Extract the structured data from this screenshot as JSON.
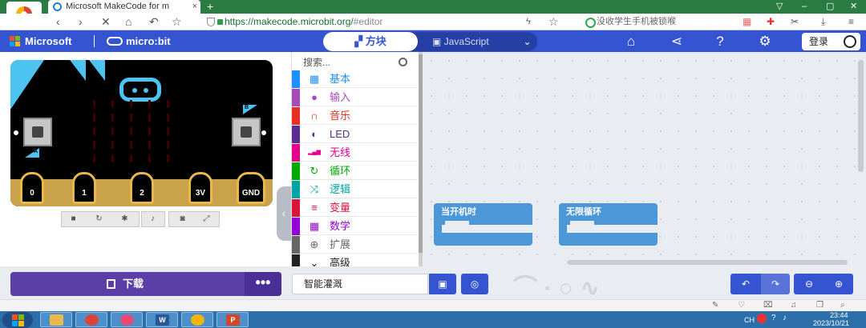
{
  "browser": {
    "tab_title": "Microsoft MakeCode for m",
    "tab_close": "×",
    "new_tab": "+",
    "url_main": "https://makecode.microbit.org/",
    "url_hash": "#editor",
    "search_text": "没收学生手机被锁喉",
    "window_controls": [
      "▽",
      "–",
      "▢",
      "✕"
    ],
    "nav_icons": [
      "back-icon",
      "forward-icon",
      "close-icon",
      "home-icon",
      "undo-icon",
      "star-icon"
    ]
  },
  "header": {
    "brand": "Microsoft",
    "product": "micro:bit",
    "mode_blocks": "方块",
    "mode_js": "JavaScript",
    "login": "登录",
    "colors": {
      "bar": "#3454d1",
      "accent": "#263fa5"
    }
  },
  "simulator": {
    "button_a": "A",
    "button_b": "B",
    "pins": [
      "0",
      "1",
      "2",
      "3V",
      "GND"
    ],
    "controls": [
      "stop-icon",
      "restart-icon",
      "debug-icon",
      "sound-icon",
      "screenshot-icon",
      "fullscreen-icon"
    ]
  },
  "toolbox": {
    "search_placeholder": "搜索...",
    "categories": [
      {
        "label": "基本",
        "color": "#1e90ff",
        "icon": "grid-icon"
      },
      {
        "label": "输入",
        "color": "#a54cb8",
        "icon": "circle-icon"
      },
      {
        "label": "音乐",
        "color": "#e63022",
        "icon": "headphones-icon"
      },
      {
        "label": "LED",
        "color": "#5c2d91",
        "icon": "toggle-icon"
      },
      {
        "label": "无线",
        "color": "#e3008c",
        "icon": "signal-icon"
      },
      {
        "label": "循环",
        "color": "#00aa00",
        "icon": "refresh-icon"
      },
      {
        "label": "逻辑",
        "color": "#00a4a6",
        "icon": "shuffle-icon"
      },
      {
        "label": "变量",
        "color": "#dc143c",
        "icon": "lines-icon"
      },
      {
        "label": "数学",
        "color": "#9400d3",
        "icon": "calculator-icon"
      },
      {
        "label": "扩展",
        "color": "#666666",
        "icon": "plus-icon"
      },
      {
        "label": "高级",
        "color": "#222222",
        "icon": "chevron-down-icon"
      }
    ]
  },
  "workspace": {
    "blocks": [
      {
        "label": "当开机时"
      },
      {
        "label": "无限循环"
      }
    ]
  },
  "bottom": {
    "download": "下载",
    "more": "•••",
    "project_name": "智能灌溉"
  },
  "taskbar": {
    "time": "23:44",
    "date": "2023/10/21",
    "lang": "CH",
    "apps": [
      "explorer-icon",
      "chrome-icon",
      "app-icon",
      "word-icon",
      "browser-icon",
      "powerpoint-icon"
    ]
  }
}
